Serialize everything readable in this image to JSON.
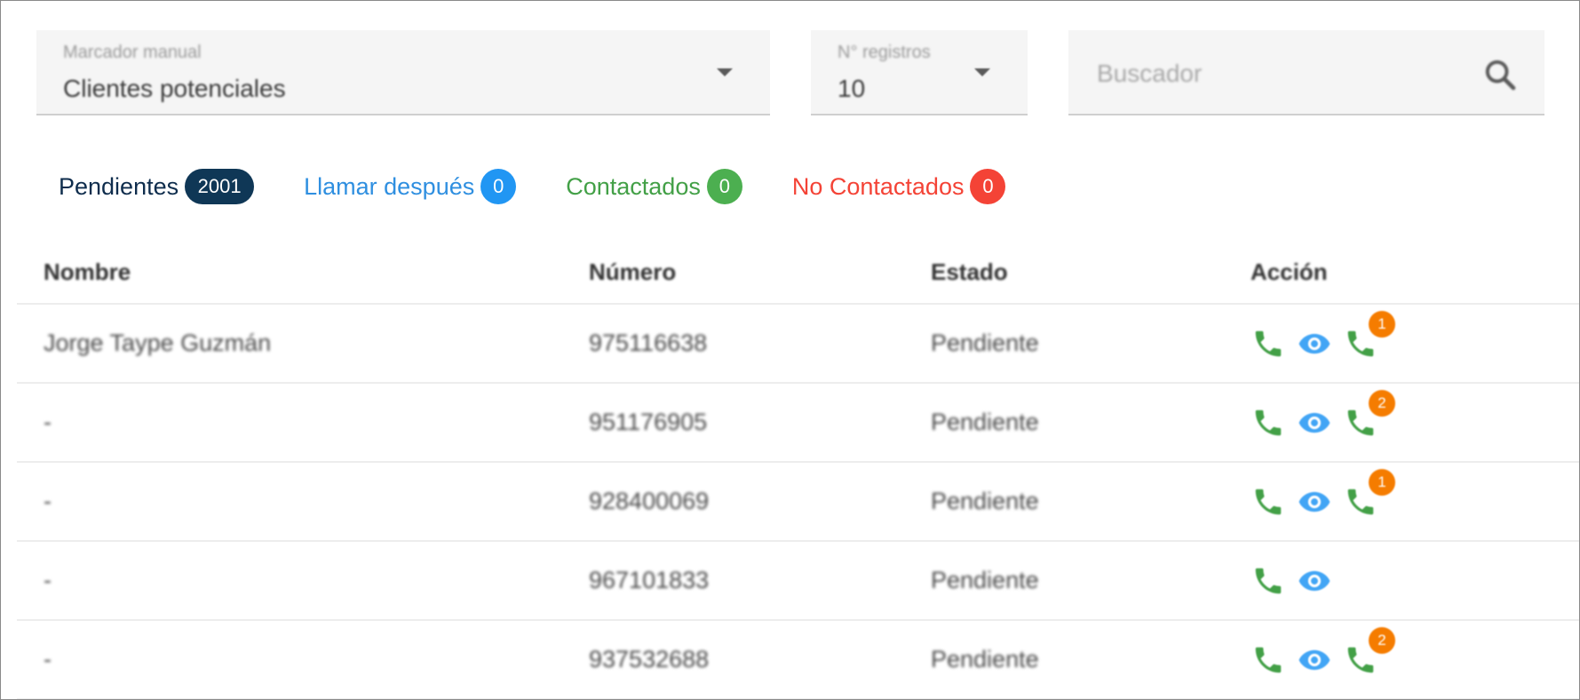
{
  "filters": {
    "dialer": {
      "label": "Marcador manual",
      "value": "Clientes potenciales"
    },
    "records": {
      "label": "N° registros",
      "value": "10"
    },
    "search": {
      "placeholder": "Buscador"
    }
  },
  "tabs": [
    {
      "label": "Pendientes",
      "count": "2001",
      "color": "#0f3756"
    },
    {
      "label": "Llamar después",
      "count": "0",
      "color": "#2196f3"
    },
    {
      "label": "Contactados",
      "count": "0",
      "color": "#4caf50"
    },
    {
      "label": "No Contactados",
      "count": "0",
      "color": "#f44336"
    }
  ],
  "table": {
    "headers": {
      "name": "Nombre",
      "number": "Número",
      "status": "Estado",
      "action": "Acción"
    },
    "rows": [
      {
        "name": "Jorge Taype Guzmán",
        "number": "975116638",
        "status": "Pendiente",
        "history_count": "1"
      },
      {
        "name": "-",
        "number": "951176905",
        "status": "Pendiente",
        "history_count": "2"
      },
      {
        "name": "-",
        "number": "928400069",
        "status": "Pendiente",
        "history_count": "1"
      },
      {
        "name": "-",
        "number": "967101833",
        "status": "Pendiente",
        "history_count": null
      },
      {
        "name": "-",
        "number": "937532688",
        "status": "Pendiente",
        "history_count": "2"
      }
    ]
  },
  "icons": {
    "call": "phone-icon",
    "view": "eye-icon",
    "history": "call-history-icon",
    "search": "search-icon",
    "dropdown": "chevron-down-icon"
  },
  "colors": {
    "call": "#43a047",
    "view": "#42a5f5",
    "history_badge": "#f57c00"
  }
}
